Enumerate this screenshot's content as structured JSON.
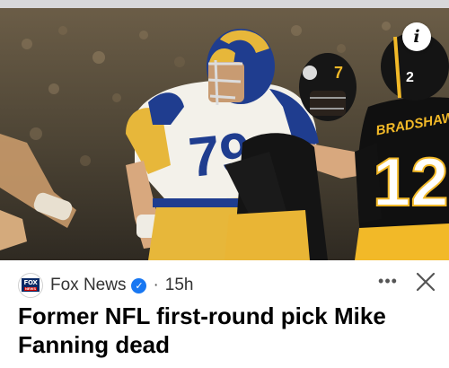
{
  "status_bar": {},
  "photo": {
    "description_icon": "info-icon",
    "info_label": "i",
    "jersey_front_number": "79",
    "opponent_helmet_number": "7",
    "opponent_number": "12",
    "opponent_nameplate": "BRADSHAW",
    "helmet_number_right": "2"
  },
  "story": {
    "source_name": "Fox News",
    "source_logo_text_top": "FOX",
    "source_logo_text_bottom": "NEWS",
    "verified_icon": "check-icon",
    "verified_mark": "✓",
    "separator": "·",
    "age": "15h",
    "more_label": "•••",
    "close_icon": "close-icon",
    "headline": "Former NFL first-round pick Mike Fanning dead"
  },
  "colors": {
    "verified_blue": "#1877f2",
    "rams_blue": "#1f3d8f",
    "rams_gold": "#e7b73a",
    "steelers_black": "#111111",
    "steelers_gold": "#f2b928"
  }
}
